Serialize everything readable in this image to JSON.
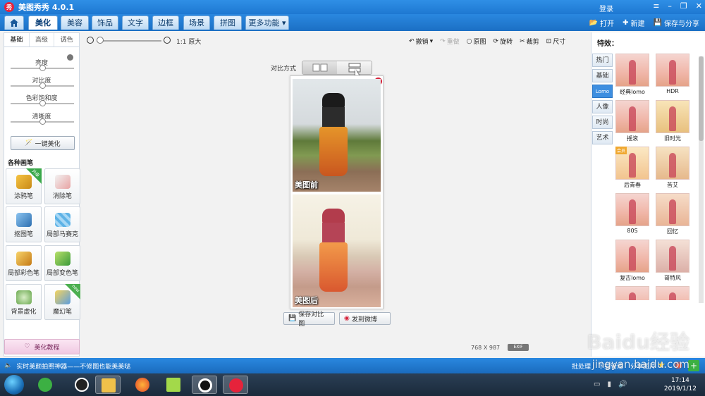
{
  "app": {
    "logo_text": "秀",
    "title": "美图秀秀 4.0.1",
    "login": "登录"
  },
  "nav": {
    "tabs": [
      "美化",
      "美容",
      "饰品",
      "文字",
      "边框",
      "场景",
      "拼图",
      "更多功能"
    ],
    "open": "打开",
    "new": "新建",
    "save_share": "保存与分享"
  },
  "left": {
    "subtabs": [
      "基础",
      "高级",
      "调色"
    ],
    "sliders": [
      {
        "label": "亮度",
        "value": 0.5
      },
      {
        "label": "对比度",
        "value": 0.5
      },
      {
        "label": "色彩饱和度",
        "value": 0.5
      },
      {
        "label": "清晰度",
        "value": 0.5
      }
    ],
    "onekey": "一键美化",
    "pens_title": "各种画笔",
    "pens": [
      "涂鸦笔",
      "消除笔",
      "抠图笔",
      "局部马赛克",
      "局部彩色笔",
      "局部变色笔",
      "背景虚化",
      "魔幻笔"
    ],
    "pen_badges": {
      "upgrade": "升级",
      "new": "new"
    },
    "tutorial": "美化教程"
  },
  "toolbar": {
    "zoom_label": "1:1 原大",
    "undo": "撤销",
    "redo": "重做",
    "original": "原图",
    "rotate": "旋转",
    "crop": "裁剪",
    "size": "尺寸"
  },
  "compare": {
    "label": "对比方式",
    "before": "美图前",
    "after": "美图后",
    "save": "保存对比图",
    "weibo": "发到微博"
  },
  "image_info": {
    "width": "768",
    "sep": "X",
    "height": "987",
    "exif": "EXIF"
  },
  "right": {
    "title": "特效：",
    "categories": [
      "热门",
      "基础",
      "Lomo",
      "人像",
      "时尚",
      "艺术"
    ],
    "active_category": "Lomo",
    "effects": [
      "经典lomo",
      "HDR",
      "摇滚",
      "旧时光",
      "后青春",
      "苦艾",
      "80S",
      "回忆",
      "复古lomo",
      "哥特风"
    ],
    "effect_badge": "会员"
  },
  "status": {
    "text": "实时美颜拍照神器——不修图也能美美哒",
    "batch": "批处理",
    "downloads": "下载管理",
    "share": "分享图片"
  },
  "taskbar": {
    "time": "17:14",
    "date": "2019/1/12"
  },
  "watermark": {
    "brand": "Baidu经验",
    "url": "jingyan.baidu.com"
  },
  "colors": {
    "accent": "#1e78d2",
    "close": "#d6233a"
  }
}
